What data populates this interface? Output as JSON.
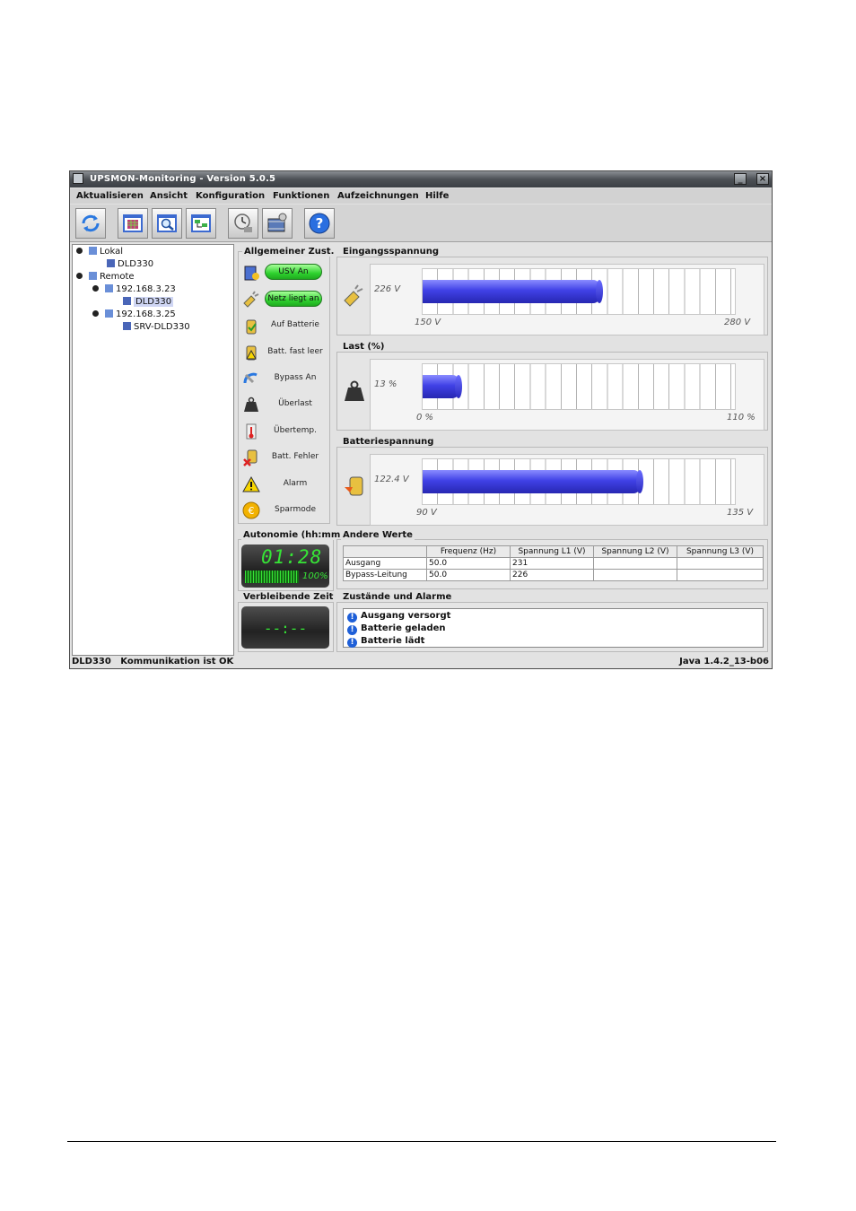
{
  "window": {
    "title": "UPSMON-Monitoring - Version 5.0.5"
  },
  "menu": [
    "Aktualisieren",
    "Ansicht",
    "Konfiguration",
    "Funktionen",
    "Aufzeichnungen",
    "Hilfe"
  ],
  "tree": {
    "lokal": "Lokal",
    "lokal_device": "DLD330",
    "remote": "Remote",
    "host1": "192.168.3.23",
    "host1_device": "DLD330",
    "host2": "192.168.3.25",
    "host2_device": "SRV-DLD330"
  },
  "status_panel": {
    "title": "Allgemeiner Zust.",
    "items": [
      {
        "label": "USV An",
        "active": true
      },
      {
        "label": "Netz liegt an",
        "active": true
      },
      {
        "label": "Auf Batterie",
        "active": false
      },
      {
        "label": "Batt. fast leer",
        "active": false
      },
      {
        "label": "Bypass An",
        "active": false
      },
      {
        "label": "Überlast",
        "active": false
      },
      {
        "label": "Übertemp.",
        "active": false
      },
      {
        "label": "Batt. Fehler",
        "active": false
      },
      {
        "label": "Alarm",
        "active": false
      },
      {
        "label": "Sparmode",
        "active": false
      }
    ]
  },
  "gauges": [
    {
      "title": "Eingangsspannung",
      "value_label": "226 V",
      "min_label": "150 V",
      "max_label": "280 V",
      "fraction": 0.58
    },
    {
      "title": "Last (%)",
      "value_label": "13 %",
      "min_label": "0 %",
      "max_label": "110 %",
      "fraction": 0.12
    },
    {
      "title": "Batteriespannung",
      "value_label": "122.4 V",
      "min_label": "90 V",
      "max_label": "135 V",
      "fraction": 0.71
    }
  ],
  "autonomy": {
    "title": "Autonomie (hh:mm",
    "time": "01:28",
    "battery": "100%",
    "battery_fraction": 1.0
  },
  "remaining": {
    "title": "Verbleibende Zeit",
    "time": "--:--"
  },
  "other_values": {
    "title": "Andere Werte",
    "headers": [
      "",
      "Frequenz (Hz)",
      "Spannung L1 (V)",
      "Spannung L2 (V)",
      "Spannung L3 (V)"
    ],
    "rows": [
      [
        "Ausgang",
        "50.0",
        "231",
        "",
        ""
      ],
      [
        "Bypass-Leitung",
        "50.0",
        "226",
        "",
        ""
      ]
    ]
  },
  "alarms": {
    "title": "Zustände und Alarme",
    "items": [
      "Ausgang versorgt",
      "Batterie geladen",
      "Batterie lädt"
    ]
  },
  "statusbar": {
    "left": "DLD330   Kommunikation ist OK",
    "right": "Java 1.4.2_13-b06"
  },
  "colors": {
    "bar": "#4041e6",
    "lcd_green": "#36e436",
    "pill_green": "#2fd22f",
    "info_blue": "#1e5fd8"
  }
}
